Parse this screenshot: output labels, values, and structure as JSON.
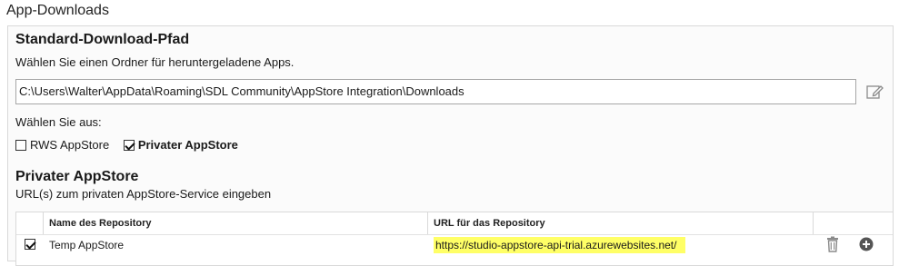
{
  "group_title": "App-Downloads",
  "download_path": {
    "title": "Standard-Download-Pfad",
    "description": "Wählen Sie einen Ordner für heruntergeladene Apps.",
    "value": "C:\\Users\\Walter\\AppData\\Roaming\\SDL Community\\AppStore Integration\\Downloads",
    "edit_icon": "edit-icon"
  },
  "selection": {
    "label": "Wählen Sie aus:",
    "options": [
      {
        "label": "RWS AppStore",
        "checked": false
      },
      {
        "label": "Privater AppStore",
        "checked": true
      }
    ]
  },
  "private_store": {
    "title": "Privater AppStore",
    "description": "URL(s) zum privaten AppStore-Service eingeben",
    "columns": [
      "Name des Repository",
      "URL für das Repository"
    ],
    "rows": [
      {
        "checked": true,
        "name": "Temp AppStore",
        "url": "https://studio-appstore-api-trial.azurewebsites.net/"
      }
    ],
    "highlight_color": "#ffff66",
    "icons": [
      "trash-icon",
      "plus-circle-icon"
    ]
  }
}
